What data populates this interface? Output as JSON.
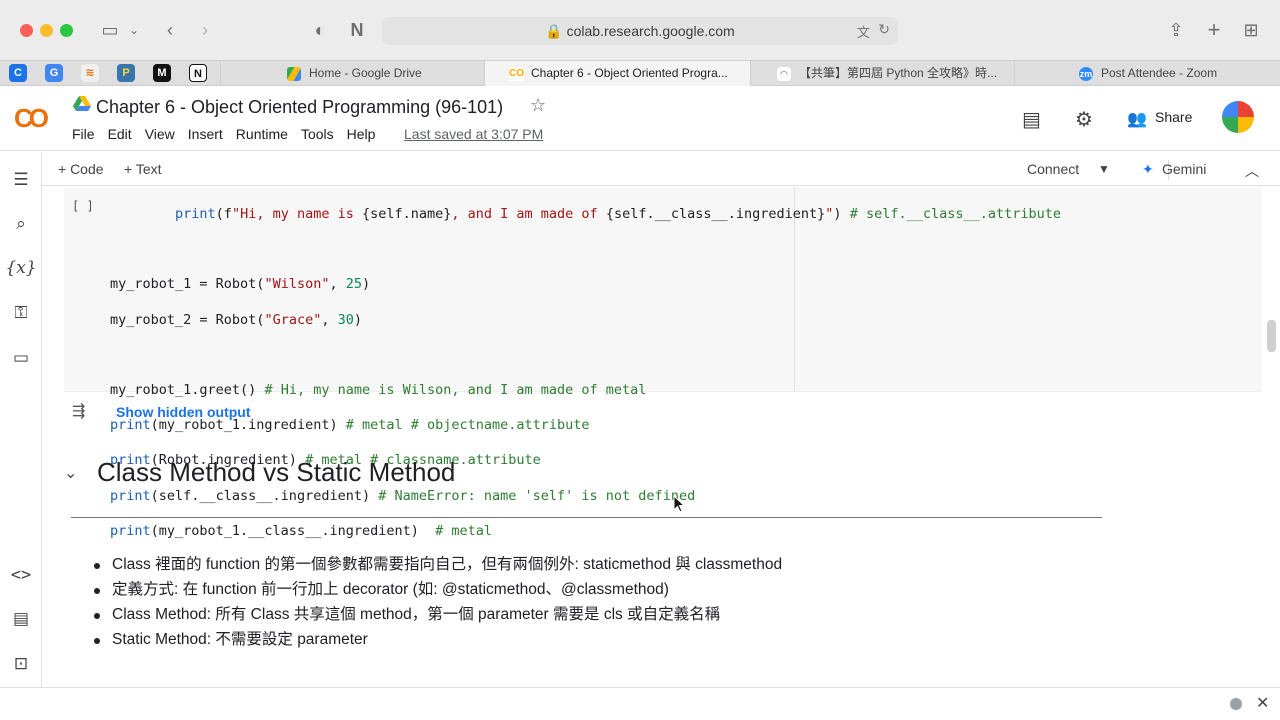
{
  "browser": {
    "url": "colab.research.google.com",
    "tabs": [
      {
        "label": "Home - Google Drive"
      },
      {
        "label": "Chapter 6 - Object Oriented Progra..."
      },
      {
        "label": "【共筆】第四屆 Python 全攻略》時..."
      },
      {
        "label": "Post Attendee - Zoom"
      }
    ]
  },
  "colab": {
    "logo": "CO",
    "title": "Chapter 6 - Object Oriented Programming (96-101)",
    "menu": [
      "File",
      "Edit",
      "View",
      "Insert",
      "Runtime",
      "Tools",
      "Help"
    ],
    "last_saved": "Last saved at 3:07 PM",
    "share_label": "Share",
    "toolbar": {
      "add_code": "+ Code",
      "add_text": "+ Text",
      "connect": "Connect",
      "gemini": "Gemini"
    }
  },
  "cell": {
    "bracket": "[ ]",
    "show_hidden_output": "Show hidden output"
  },
  "section": {
    "title": "Class Method vs Static Method",
    "bullets": [
      "Class 裡面的 function 的第一個參數都需要指向自己，但有兩個例外: staticmethod 與 classmethod",
      "定義方式: 在 function 前一行加上 decorator (如: @staticmethod、@classmethod)",
      "Class Method: 所有 Class 共享這個 method，第一個 parameter 需要是 cls 或自定義名稱",
      "Static Method: 不需要設定 parameter"
    ]
  }
}
